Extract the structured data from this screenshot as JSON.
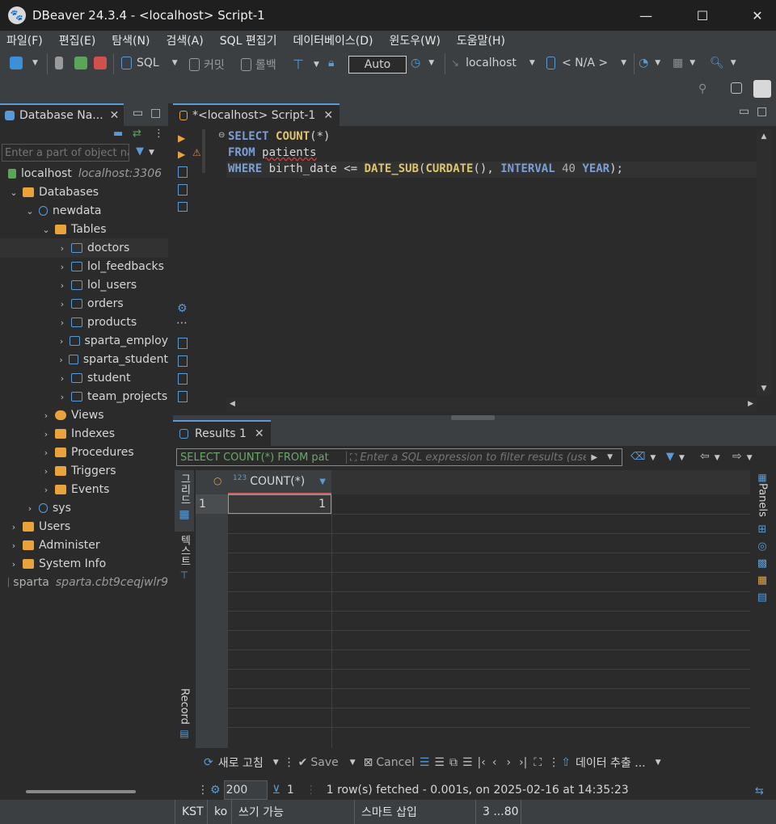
{
  "window": {
    "title": "DBeaver 24.3.4 - <localhost> Script-1",
    "minimize": "—",
    "maximize": "☐",
    "close": "✕"
  },
  "menu": [
    "파일(F)",
    "편집(E)",
    "탐색(N)",
    "검색(A)",
    "SQL 편집기",
    "데이터베이스(D)",
    "윈도우(W)",
    "도움말(H)"
  ],
  "toolbar": {
    "sql_label": "SQL",
    "commit_label": "커밋",
    "rollback_label": "롤백",
    "auto_label": "Auto",
    "connection_label": "localhost",
    "schema_label": "< N/A >"
  },
  "navigator": {
    "tab_label": "Database Na...",
    "filter_placeholder": "Enter a part of object na",
    "tree": {
      "localhost": "localhost",
      "localhost_host": "localhost:3306",
      "databases": "Databases",
      "newdata": "newdata",
      "tables": "Tables",
      "table_items": [
        "doctors",
        "lol_feedbacks",
        "lol_users",
        "orders",
        "products",
        "sparta_employ",
        "sparta_student",
        "student",
        "team_projects"
      ],
      "views": "Views",
      "indexes": "Indexes",
      "procedures": "Procedures",
      "triggers": "Triggers",
      "events": "Events",
      "sys": "sys",
      "users": "Users",
      "administer": "Administer",
      "system_info": "System Info",
      "sparta": "sparta",
      "sparta_host": "sparta.cbt9ceqjwlr9"
    }
  },
  "editor": {
    "tab_label": "*<localhost> Script-1",
    "line1_kw": "SELECT",
    "line1_fn": "COUNT",
    "line1_rest": "(*)",
    "line2_kw": "FROM",
    "line2_rest": "patients",
    "line3_kw": "WHERE",
    "line3_col": "birth_date <=",
    "line3_fn1": "DATE_SUB",
    "line3_p1": "(",
    "line3_fn2": "CURDATE",
    "line3_p2": "(), ",
    "line3_kw2": "INTERVAL",
    "line3_num": "40",
    "line3_kw3": "YEAR",
    "line3_end": ");"
  },
  "results": {
    "tab_label": "Results 1",
    "query_preview": "SELECT COUNT(*) FROM pat",
    "filter_placeholder": "Enter a SQL expression to filter results (use",
    "side_grid": "그리드",
    "side_text": "텍스트",
    "side_record": "Record",
    "panels_label": "Panels",
    "column_type": "123",
    "column_header": "COUNT(*)",
    "rows": [
      {
        "num": "1",
        "value": "1"
      }
    ],
    "refresh_label": "새로 고침",
    "save_label": "Save",
    "cancel_label": "Cancel",
    "export_label": "데이터 추출 ...",
    "fetch_size": "200",
    "row_count": "1",
    "status_message": "1 row(s) fetched - 0.001s, on 2025-02-16 at 14:35:23"
  },
  "statusbar": {
    "timezone": "KST",
    "locale": "ko",
    "writable": "쓰기 가능",
    "insert_mode": "스마트 삽입",
    "position": "3 ...80"
  }
}
